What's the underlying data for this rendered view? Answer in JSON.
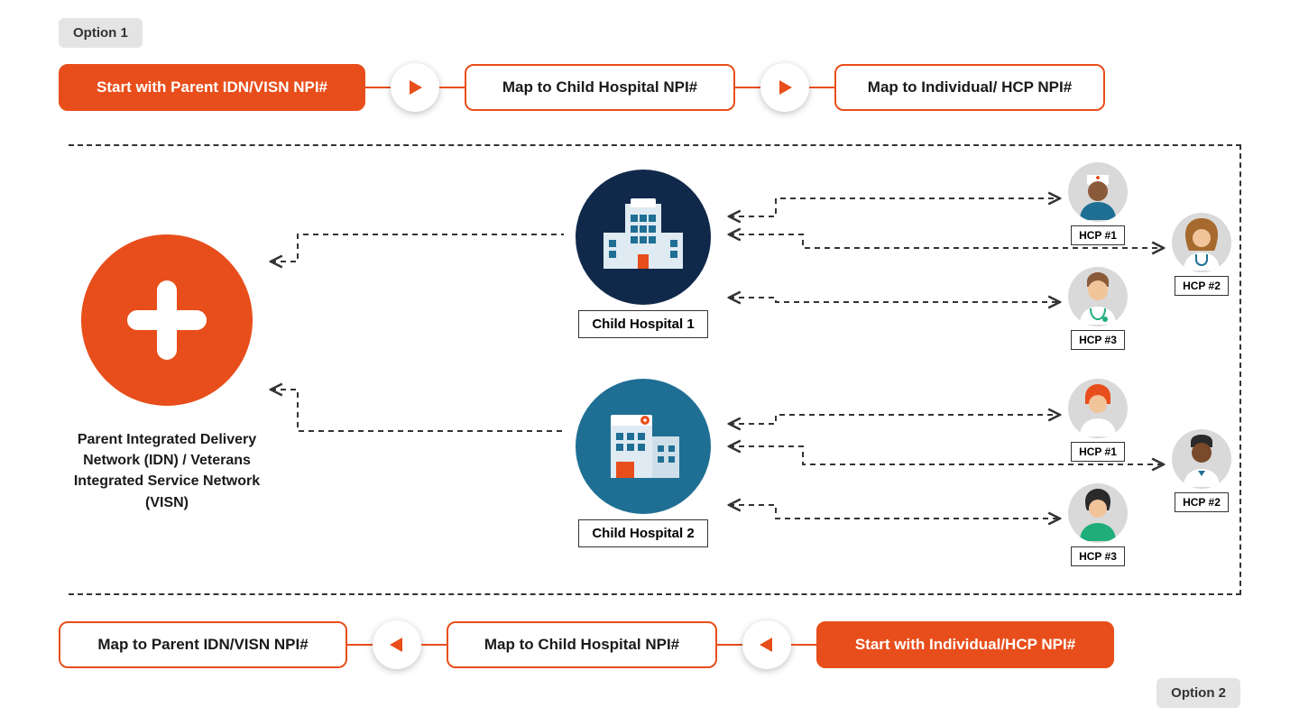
{
  "options": {
    "top": "Option 1",
    "bottom": "Option 2"
  },
  "flow_top": {
    "box1": "Start with Parent IDN/VISN NPI#",
    "box2": "Map to Child Hospital NPI#",
    "box3": "Map to Individual/ HCP NPI#"
  },
  "flow_bottom": {
    "box1": "Map to Parent IDN/VISN NPI#",
    "box2": "Map to Child Hospital NPI#",
    "box3": "Start with Individual/HCP NPI#"
  },
  "parent": {
    "label": "Parent Integrated Delivery Network (IDN) / Veterans Integrated Service Network (VISN)"
  },
  "hospitals": {
    "h1": "Child Hospital 1",
    "h2": "Child Hospital 2"
  },
  "hcp_set1": {
    "a": "HCP #1",
    "b": "HCP #2",
    "c": "HCP #3"
  },
  "hcp_set2": {
    "a": "HCP #1",
    "b": "HCP #2",
    "c": "HCP #3"
  },
  "colors": {
    "accent": "#e84e1b",
    "navy": "#10294b",
    "teal": "#1f6f94"
  }
}
